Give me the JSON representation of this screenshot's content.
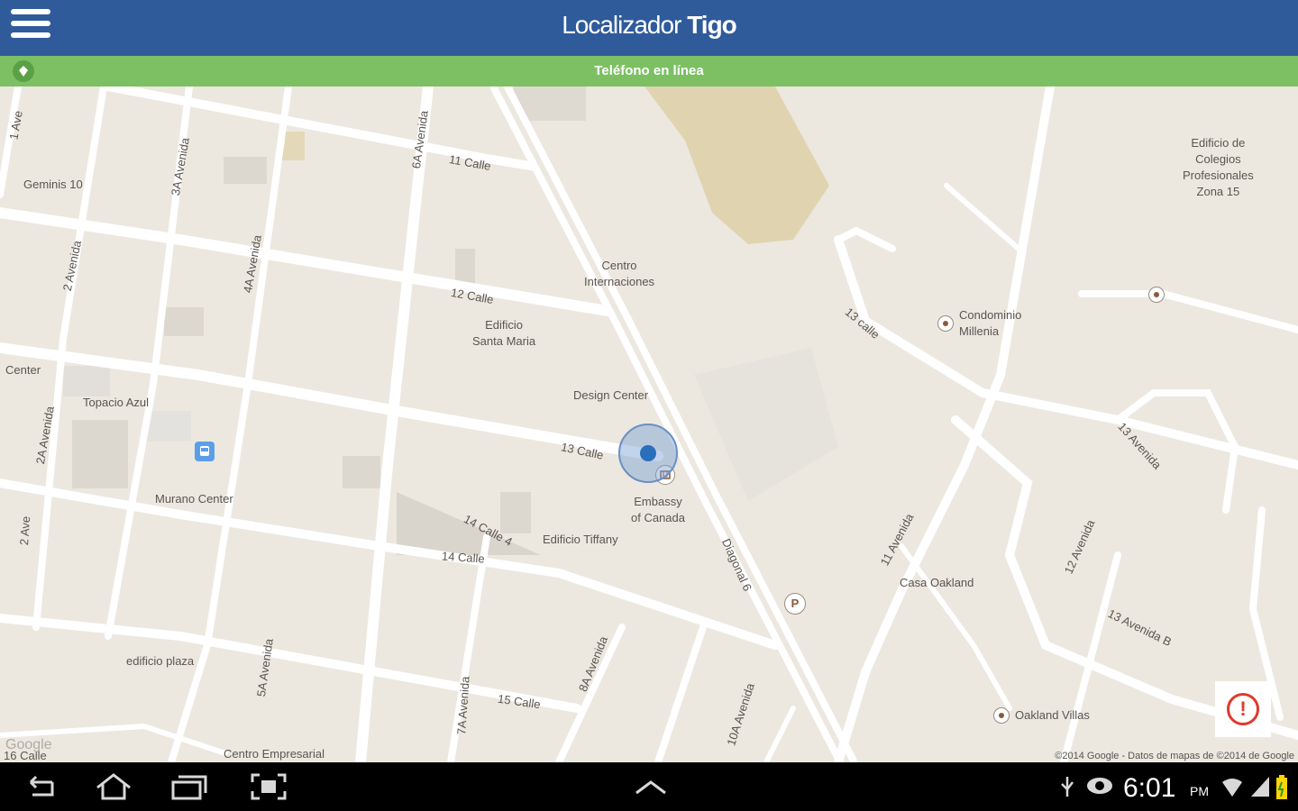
{
  "app": {
    "title_part1": "Localizador",
    "title_part2": "Tigo",
    "status": "Teléfono en línea"
  },
  "colors": {
    "header": "#2f5b9b",
    "status_bar": "#7cc063",
    "location_dot": "#2a6fbb",
    "alert": "#e03a2d"
  },
  "map": {
    "streets": [
      "1 Ave",
      "11 Calle",
      "3A Avenida",
      "6A Avenida",
      "2 Avenida",
      "4A Avenida",
      "12 Calle",
      "13 Calle",
      "2A Avenida",
      "14 Calle 4",
      "14 Calle",
      "2 Ave",
      "5A Avenida",
      "7A Avenida",
      "15 Calle",
      "8A Avenida",
      "10A Avenida",
      "Diagonal 6",
      "11 Avenida",
      "12 Avenida",
      "13 Avenida",
      "13 Avenida B",
      "13 calle",
      "16 Calle"
    ],
    "places": {
      "geminis": "Geminis 10",
      "centro_inter_1": "Centro",
      "centro_inter_2": "Internaciones",
      "edificio_sm_1": "Edificio",
      "edificio_sm_2": "Santa Maria",
      "center": "Center",
      "topacio": "Topacio Azul",
      "design": "Design Center",
      "embassy_1": "Embassy",
      "embassy_2": "of Canada",
      "murano": "Murano Center",
      "tiffany": "Edificio Tiffany",
      "plaza": "edificio plaza",
      "empresarial": "Centro Empresarial",
      "colegios_1": "Edificio de",
      "colegios_2": "Colegios",
      "colegios_3": "Profesionales",
      "colegios_4": "Zona 15",
      "condominio_1": "Condominio",
      "condominio_2": "Millenia",
      "oakland": "Casa Oakland",
      "oakland_villas": "Oakland Villas"
    },
    "google_logo": "Google",
    "copyright": "©2014 Google - Datos de mapas de ©2014 de Google",
    "alert_glyph": "!"
  },
  "system": {
    "time": "6:01",
    "ampm": "PM"
  }
}
